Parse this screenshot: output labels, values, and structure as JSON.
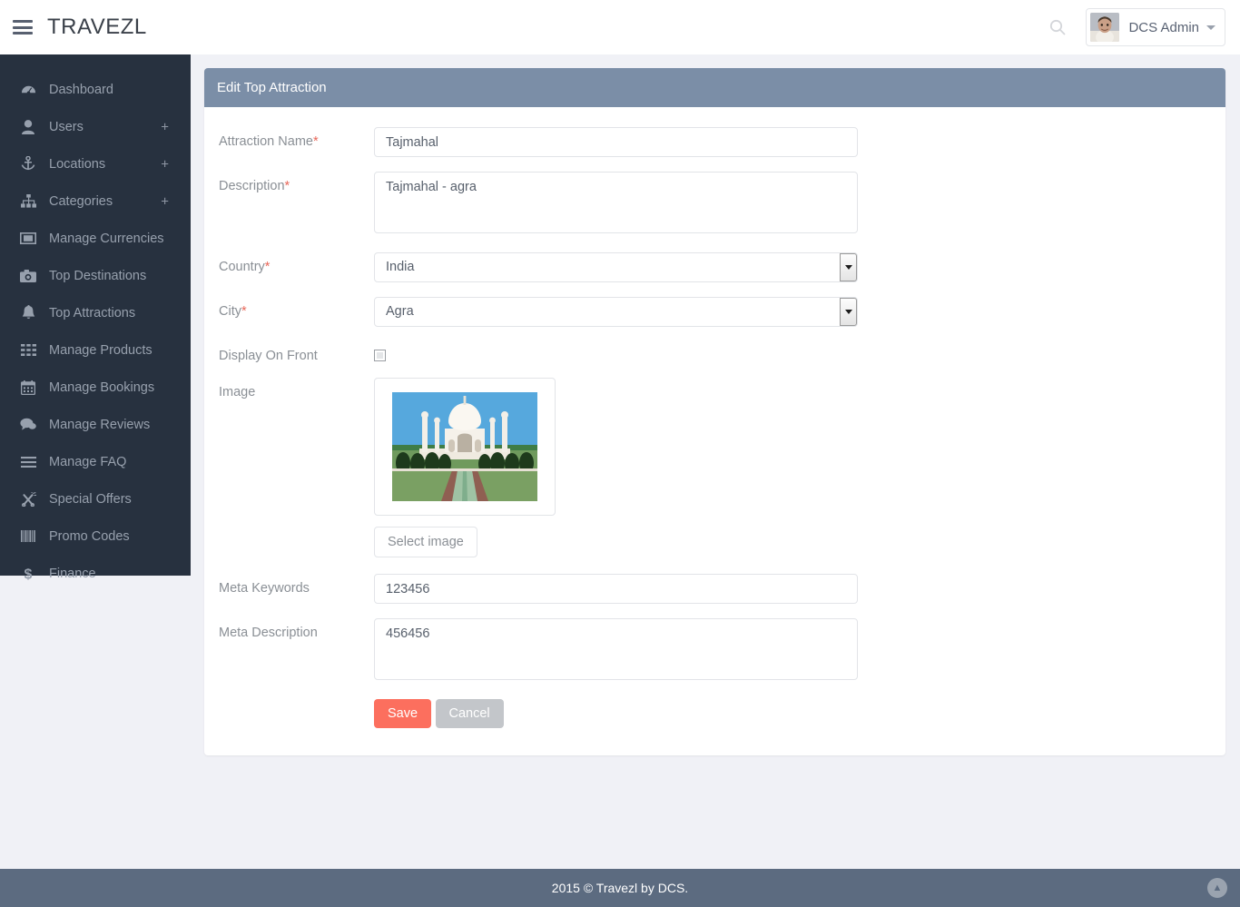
{
  "header": {
    "brand": "TRAVEZL",
    "menu_icon": "hamburger-icon",
    "search_icon": "search-icon",
    "user_name": "DCS Admin",
    "caret_icon": "chevron-down-icon"
  },
  "sidebar": {
    "items": [
      {
        "label": "Dashboard",
        "icon": "dashboard-icon",
        "expandable": false
      },
      {
        "label": "Users",
        "icon": "user-icon",
        "expandable": true,
        "expand_label": "+"
      },
      {
        "label": "Locations",
        "icon": "anchor-icon",
        "expandable": true,
        "expand_label": "+"
      },
      {
        "label": "Categories",
        "icon": "sitemap-icon",
        "expandable": true,
        "expand_label": "+"
      },
      {
        "label": "Manage Currencies",
        "icon": "money-icon",
        "expandable": false
      },
      {
        "label": "Top Destinations",
        "icon": "camera-icon",
        "expandable": false
      },
      {
        "label": "Top Attractions",
        "icon": "bell-icon",
        "expandable": false
      },
      {
        "label": "Manage Products",
        "icon": "grid-icon",
        "expandable": false
      },
      {
        "label": "Manage Bookings",
        "icon": "calendar-icon",
        "expandable": false
      },
      {
        "label": "Manage Reviews",
        "icon": "comments-icon",
        "expandable": false
      },
      {
        "label": "Manage FAQ",
        "icon": "list-icon",
        "expandable": false
      },
      {
        "label": "Special Offers",
        "icon": "tag-cut-icon",
        "expandable": false
      },
      {
        "label": "Promo Codes",
        "icon": "barcode-icon",
        "expandable": false
      },
      {
        "label": "Finance",
        "icon": "dollar-icon",
        "expandable": false
      }
    ]
  },
  "panel": {
    "title": "Edit Top Attraction",
    "fields": {
      "attraction_name": {
        "label": "Attraction Name",
        "required": "*",
        "value": "Tajmahal"
      },
      "description": {
        "label": "Description",
        "required": "*",
        "value": "Tajmahal - agra"
      },
      "country": {
        "label": "Country",
        "required": "*",
        "value": "India"
      },
      "city": {
        "label": "City",
        "required": "*",
        "value": "Agra"
      },
      "display_on_front": {
        "label": "Display On Front",
        "checked": false
      },
      "image": {
        "label": "Image",
        "select_button": "Select image",
        "alt": "taj-mahal-thumbnail"
      },
      "meta_keywords": {
        "label": "Meta Keywords",
        "value": "123456"
      },
      "meta_description": {
        "label": "Meta Description",
        "value": "456456"
      }
    },
    "actions": {
      "save": "Save",
      "cancel": "Cancel"
    }
  },
  "footer": {
    "copyright": "2015 © Travezl by DCS.",
    "to_top_icon": "chevron-up-icon",
    "to_top_glyph": "▲"
  },
  "colors": {
    "sidebar": "#27313f",
    "panel_header": "#7b8ea7",
    "footer": "#5c6b80",
    "save": "#fc6f5e",
    "cancel": "#c3c6ca",
    "required": "#e8685a",
    "page_bg": "#f0f1f6"
  }
}
